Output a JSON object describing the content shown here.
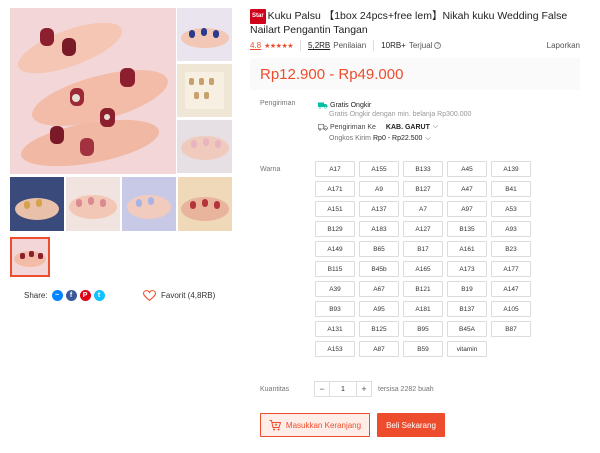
{
  "product": {
    "badge": "Star",
    "title": "Kuku Palsu 【1box 24pcs+free lem】Nikah kuku Wedding False Nailart Pengantin Tangan",
    "rating": "4.8",
    "rating_count": "5,2RB",
    "rating_label": "Penilaian",
    "sold_count": "10RB+",
    "sold_label": "Terjual",
    "report": "Laporkan",
    "price": "Rp12.900 - Rp49.000"
  },
  "share": {
    "label": "Share:"
  },
  "favorite": {
    "label": "Favorit (4,8RB)"
  },
  "shipping": {
    "label": "Pengiriman",
    "free": "Gratis Ongkir",
    "free_note": "Gratis Ongkir dengan min. belanja Rp300.000",
    "to_label": "Pengiriman Ke",
    "to_value": "KAB. GARUT",
    "cost_label": "Ongkos Kirim",
    "cost_value": "Rp0 - Rp22.500"
  },
  "variant": {
    "label": "Warna",
    "options": [
      "A17",
      "A155",
      "B133",
      "A45",
      "A139",
      "A171",
      "A9",
      "B127",
      "A47",
      "B41",
      "A151",
      "A137",
      "A7",
      "A97",
      "A53",
      "B129",
      "A183",
      "A127",
      "B135",
      "A93",
      "A149",
      "B65",
      "B17",
      "A161",
      "B23",
      "B115",
      "B45b",
      "A165",
      "A173",
      "A177",
      "A39",
      "A67",
      "B121",
      "B19",
      "A147",
      "B93",
      "A95",
      "A181",
      "B137",
      "A105",
      "A131",
      "B125",
      "B95",
      "B45A",
      "B87",
      "A153",
      "A87",
      "B59",
      "vitamin"
    ]
  },
  "quantity": {
    "label": "Kuantitas",
    "value": "1",
    "minus": "−",
    "plus": "+",
    "stock": "tersisa 2282 buah"
  },
  "actions": {
    "cart": "Masukkan Keranjang",
    "buy": "Beli Sekarang"
  },
  "colors": {
    "accent": "#ee4d2d"
  }
}
